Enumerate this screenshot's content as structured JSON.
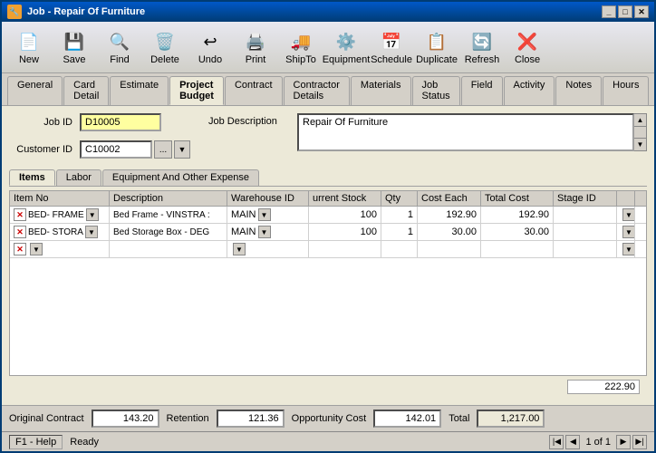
{
  "window": {
    "title": "Job - Repair Of Furniture",
    "icon": "🔧"
  },
  "titlebar_buttons": [
    "_",
    "□",
    "✕"
  ],
  "toolbar": {
    "buttons": [
      {
        "name": "new",
        "label": "New",
        "icon": "📄"
      },
      {
        "name": "save",
        "label": "Save",
        "icon": "💾"
      },
      {
        "name": "find",
        "label": "Find",
        "icon": "🔍"
      },
      {
        "name": "delete",
        "label": "Delete",
        "icon": "🗑️"
      },
      {
        "name": "undo",
        "label": "Undo",
        "icon": "↩"
      },
      {
        "name": "print",
        "label": "Print",
        "icon": "🖨️"
      },
      {
        "name": "shipto",
        "label": "ShipTo",
        "icon": "🚚"
      },
      {
        "name": "equipment",
        "label": "Equipment",
        "icon": "⚙️"
      },
      {
        "name": "schedule",
        "label": "Schedule",
        "icon": "📅"
      },
      {
        "name": "duplicate",
        "label": "Duplicate",
        "icon": "📋"
      },
      {
        "name": "refresh",
        "label": "Refresh",
        "icon": "🔄"
      },
      {
        "name": "close",
        "label": "Close",
        "icon": "❌"
      }
    ]
  },
  "tabs_top": [
    {
      "id": "general",
      "label": "General"
    },
    {
      "id": "card-detail",
      "label": "Card Detail"
    },
    {
      "id": "estimate",
      "label": "Estimate"
    },
    {
      "id": "project-budget",
      "label": "Project Budget",
      "active": true
    },
    {
      "id": "contract",
      "label": "Contract"
    },
    {
      "id": "contractor-details",
      "label": "Contractor Details"
    },
    {
      "id": "materials",
      "label": "Materials"
    },
    {
      "id": "job-status",
      "label": "Job Status"
    },
    {
      "id": "field",
      "label": "Field"
    },
    {
      "id": "activity",
      "label": "Activity"
    },
    {
      "id": "notes",
      "label": "Notes"
    },
    {
      "id": "hours",
      "label": "Hours"
    }
  ],
  "form": {
    "job_id_label": "Job ID",
    "job_id_value": "D10005",
    "customer_id_label": "Customer ID",
    "customer_id_value": "C10002",
    "job_description_label": "Job Description",
    "job_description_value": "Repair Of Furniture"
  },
  "sub_tabs": [
    {
      "id": "items",
      "label": "Items",
      "active": true
    },
    {
      "id": "labor",
      "label": "Labor"
    },
    {
      "id": "equipment",
      "label": "Equipment And Other Expense"
    }
  ],
  "grid": {
    "columns": [
      "Item No",
      "Description",
      "Warehouse ID",
      "urrent Stock",
      "Qty",
      "Cost Each",
      "Total Cost",
      "Stage ID",
      ""
    ],
    "rows": [
      {
        "item_no": "BED- FRAME",
        "description": "Bed Frame - VINSTRA :",
        "warehouse_id": "MAIN",
        "current_stock": "100",
        "qty": "1",
        "cost_each": "192.90",
        "total_cost": "192.90",
        "stage_id": ""
      },
      {
        "item_no": "BED- STORA",
        "description": "Bed Storage Box - DEG",
        "warehouse_id": "MAIN",
        "current_stock": "100",
        "qty": "1",
        "cost_each": "30.00",
        "total_cost": "30.00",
        "stage_id": ""
      }
    ],
    "total": "222.90"
  },
  "bottom": {
    "original_contract_label": "Original Contract",
    "original_contract_value": "143.20",
    "retention_label": "Retention",
    "retention_value": "121.36",
    "opportunity_cost_label": "Opportunity Cost",
    "opportunity_cost_value": "142.01",
    "total_label": "Total",
    "total_value": "1,217.00"
  },
  "status_bar": {
    "help_label": "F1 - Help",
    "status_text": "Ready",
    "page_info": "1 of 1"
  }
}
